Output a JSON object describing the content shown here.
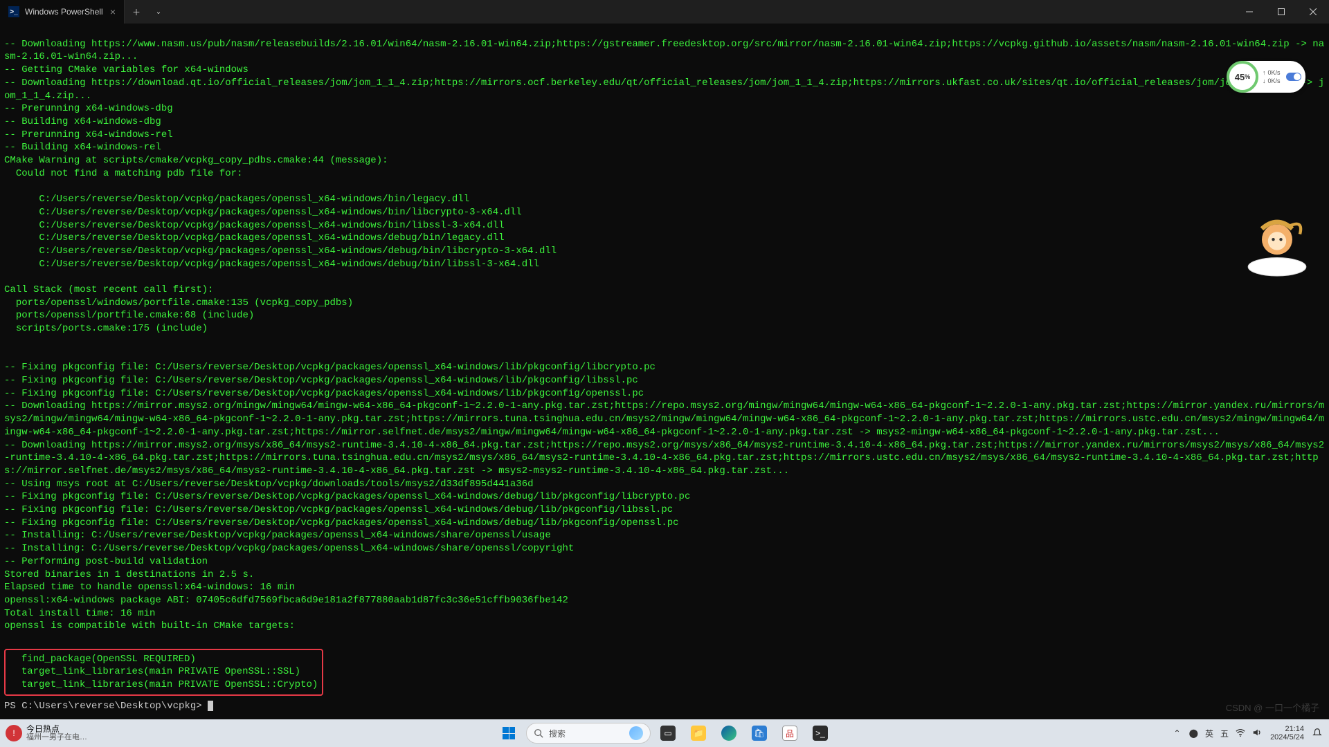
{
  "window": {
    "tab_title": "Windows PowerShell"
  },
  "terminal": {
    "lines": [
      "-- Downloading https://www.nasm.us/pub/nasm/releasebuilds/2.16.01/win64/nasm-2.16.01-win64.zip;https://gstreamer.freedesktop.org/src/mirror/nasm-2.16.01-win64.zip;https://vcpkg.github.io/assets/nasm/nasm-2.16.01-win64.zip -> nasm-2.16.01-win64.zip...",
      "-- Getting CMake variables for x64-windows",
      "-- Downloading https://download.qt.io/official_releases/jom/jom_1_1_4.zip;https://mirrors.ocf.berkeley.edu/qt/official_releases/jom/jom_1_1_4.zip;https://mirrors.ukfast.co.uk/sites/qt.io/official_releases/jom/jom_1_1_4.zip -> jom_1_1_4.zip...",
      "-- Prerunning x64-windows-dbg",
      "-- Building x64-windows-dbg",
      "-- Prerunning x64-windows-rel",
      "-- Building x64-windows-rel",
      "CMake Warning at scripts/cmake/vcpkg_copy_pdbs.cmake:44 (message):",
      "  Could not find a matching pdb file for:",
      "",
      "      C:/Users/reverse/Desktop/vcpkg/packages/openssl_x64-windows/bin/legacy.dll",
      "      C:/Users/reverse/Desktop/vcpkg/packages/openssl_x64-windows/bin/libcrypto-3-x64.dll",
      "      C:/Users/reverse/Desktop/vcpkg/packages/openssl_x64-windows/bin/libssl-3-x64.dll",
      "      C:/Users/reverse/Desktop/vcpkg/packages/openssl_x64-windows/debug/bin/legacy.dll",
      "      C:/Users/reverse/Desktop/vcpkg/packages/openssl_x64-windows/debug/bin/libcrypto-3-x64.dll",
      "      C:/Users/reverse/Desktop/vcpkg/packages/openssl_x64-windows/debug/bin/libssl-3-x64.dll",
      "",
      "Call Stack (most recent call first):",
      "  ports/openssl/windows/portfile.cmake:135 (vcpkg_copy_pdbs)",
      "  ports/openssl/portfile.cmake:68 (include)",
      "  scripts/ports.cmake:175 (include)",
      "",
      "",
      "-- Fixing pkgconfig file: C:/Users/reverse/Desktop/vcpkg/packages/openssl_x64-windows/lib/pkgconfig/libcrypto.pc",
      "-- Fixing pkgconfig file: C:/Users/reverse/Desktop/vcpkg/packages/openssl_x64-windows/lib/pkgconfig/libssl.pc",
      "-- Fixing pkgconfig file: C:/Users/reverse/Desktop/vcpkg/packages/openssl_x64-windows/lib/pkgconfig/openssl.pc",
      "-- Downloading https://mirror.msys2.org/mingw/mingw64/mingw-w64-x86_64-pkgconf-1~2.2.0-1-any.pkg.tar.zst;https://repo.msys2.org/mingw/mingw64/mingw-w64-x86_64-pkgconf-1~2.2.0-1-any.pkg.tar.zst;https://mirror.yandex.ru/mirrors/msys2/mingw/mingw64/mingw-w64-x86_64-pkgconf-1~2.2.0-1-any.pkg.tar.zst;https://mirrors.tuna.tsinghua.edu.cn/msys2/mingw/mingw64/mingw-w64-x86_64-pkgconf-1~2.2.0-1-any.pkg.tar.zst;https://mirrors.ustc.edu.cn/msys2/mingw/mingw64/mingw-w64-x86_64-pkgconf-1~2.2.0-1-any.pkg.tar.zst;https://mirror.selfnet.de/msys2/mingw/mingw64/mingw-w64-x86_64-pkgconf-1~2.2.0-1-any.pkg.tar.zst -> msys2-mingw-w64-x86_64-pkgconf-1~2.2.0-1-any.pkg.tar.zst...",
      "-- Downloading https://mirror.msys2.org/msys/x86_64/msys2-runtime-3.4.10-4-x86_64.pkg.tar.zst;https://repo.msys2.org/msys/x86_64/msys2-runtime-3.4.10-4-x86_64.pkg.tar.zst;https://mirror.yandex.ru/mirrors/msys2/msys/x86_64/msys2-runtime-3.4.10-4-x86_64.pkg.tar.zst;https://mirrors.tuna.tsinghua.edu.cn/msys2/msys/x86_64/msys2-runtime-3.4.10-4-x86_64.pkg.tar.zst;https://mirrors.ustc.edu.cn/msys2/msys/x86_64/msys2-runtime-3.4.10-4-x86_64.pkg.tar.zst;https://mirror.selfnet.de/msys2/msys/x86_64/msys2-runtime-3.4.10-4-x86_64.pkg.tar.zst -> msys2-msys2-runtime-3.4.10-4-x86_64.pkg.tar.zst...",
      "-- Using msys root at C:/Users/reverse/Desktop/vcpkg/downloads/tools/msys2/d33df895d441a36d",
      "-- Fixing pkgconfig file: C:/Users/reverse/Desktop/vcpkg/packages/openssl_x64-windows/debug/lib/pkgconfig/libcrypto.pc",
      "-- Fixing pkgconfig file: C:/Users/reverse/Desktop/vcpkg/packages/openssl_x64-windows/debug/lib/pkgconfig/libssl.pc",
      "-- Fixing pkgconfig file: C:/Users/reverse/Desktop/vcpkg/packages/openssl_x64-windows/debug/lib/pkgconfig/openssl.pc",
      "-- Installing: C:/Users/reverse/Desktop/vcpkg/packages/openssl_x64-windows/share/openssl/usage",
      "-- Installing: C:/Users/reverse/Desktop/vcpkg/packages/openssl_x64-windows/share/openssl/copyright",
      "-- Performing post-build validation",
      "Stored binaries in 1 destinations in 2.5 s.",
      "Elapsed time to handle openssl:x64-windows: 16 min",
      "openssl:x64-windows package ABI: 07405c6dfd7569fbca6d9e181a2f877880aab1d87fc3c36e51cffb9036fbe142",
      "Total install time: 16 min",
      "openssl is compatible with built-in CMake targets:"
    ],
    "boxed": [
      "  find_package(OpenSSL REQUIRED)",
      "  target_link_libraries(main PRIVATE OpenSSL::SSL)",
      "  target_link_libraries(main PRIVATE OpenSSL::Crypto)"
    ],
    "prompt": "PS C:\\Users\\reverse\\Desktop\\vcpkg> "
  },
  "netwidget": {
    "percent": "45",
    "percent_unit": "%",
    "up": "0K/s",
    "down": "0K/s"
  },
  "taskbar": {
    "news_title": "今日热点",
    "news_sub": "福州一男子在电…",
    "search_placeholder": "搜索",
    "ime_lang": "英",
    "ime_mode": "五",
    "time": "21:14",
    "date": "2024/5/24"
  },
  "watermark": "CSDN @ 一口一个橘子"
}
